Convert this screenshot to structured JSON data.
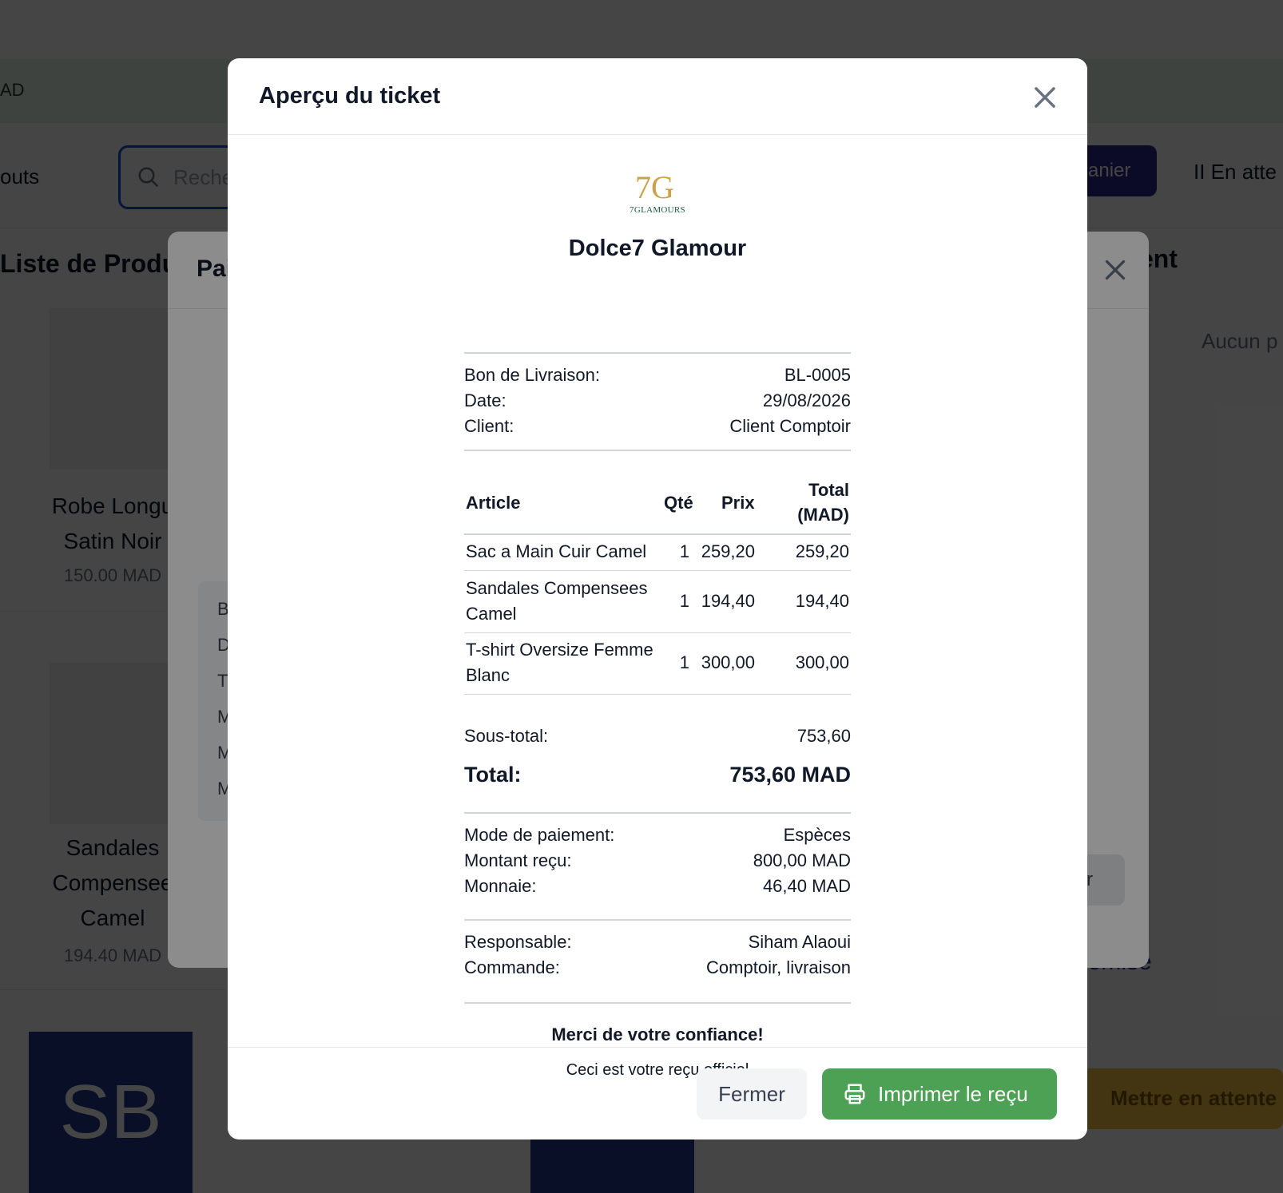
{
  "background": {
    "topbar_text": "AD",
    "toolbar_label": "outs",
    "search_placeholder": "Reche",
    "cart_button": "anier",
    "pause_label": "II  En atte",
    "section_title": "Liste de Produ",
    "section_title_right": "ent",
    "empty_text": "Aucun p",
    "products": [
      {
        "name_line1": "Robe Longu",
        "name_line2": "Satin Noir",
        "price": "150.00 MAD"
      },
      {
        "name_line1": "Sandales",
        "name_line2": "Compensee",
        "name_line3": "Camel",
        "price": "194.40 MAD"
      }
    ],
    "tile_text": "SB",
    "remise_link": "Remise",
    "hold_button": "Mettre en attente",
    "payment_modal": {
      "title": "Pai",
      "letters": [
        "B",
        "D",
        "T",
        "M",
        "M",
        "M"
      ],
      "right_button": "r"
    }
  },
  "modal": {
    "title": "Aperçu du ticket",
    "close_icon": "close-icon"
  },
  "ticket": {
    "logo_mark": "7G",
    "logo_text": "7GLAMOURS",
    "shop_name": "Dolce7 Glamour",
    "info": [
      {
        "label": "Bon de Livraison:",
        "value": "BL-0005"
      },
      {
        "label": "Date:",
        "value": "29/08/2026"
      },
      {
        "label": "Client:",
        "value": "Client Comptoir"
      }
    ],
    "columns": {
      "article": "Article",
      "qty": "Qté",
      "price": "Prix",
      "total_line1": "Total",
      "total_line2": "(MAD)"
    },
    "items": [
      {
        "name": "Sac a Main Cuir Camel",
        "qty": "1",
        "price": "259,20",
        "total": "259,20"
      },
      {
        "name": "Sandales Compensees Camel",
        "qty": "1",
        "price": "194,40",
        "total": "194,40"
      },
      {
        "name": "T-shirt Oversize Femme Blanc",
        "qty": "1",
        "price": "300,00",
        "total": "300,00"
      }
    ],
    "subtotal_label": "Sous-total:",
    "subtotal_value": "753,60",
    "total_label": "Total:",
    "total_value": "753,60 MAD",
    "payment": [
      {
        "label": "Mode de paiement:",
        "value": "Espèces"
      },
      {
        "label": "Montant reçu:",
        "value": "800,00 MAD"
      },
      {
        "label": "Monnaie:",
        "value": "46,40 MAD"
      }
    ],
    "meta": [
      {
        "label": "Responsable:",
        "value": "Siham Alaoui"
      },
      {
        "label": "Commande:",
        "value": "Comptoir, livraison"
      }
    ],
    "thanks": "Merci de votre confiance!",
    "official": "Ceci est votre reçu officiel"
  },
  "footer": {
    "close_label": "Fermer",
    "print_label": "Imprimer le reçu",
    "print_icon": "printer-icon",
    "colors": {
      "print": "#4ca154",
      "close": "#f3f4f6"
    }
  }
}
